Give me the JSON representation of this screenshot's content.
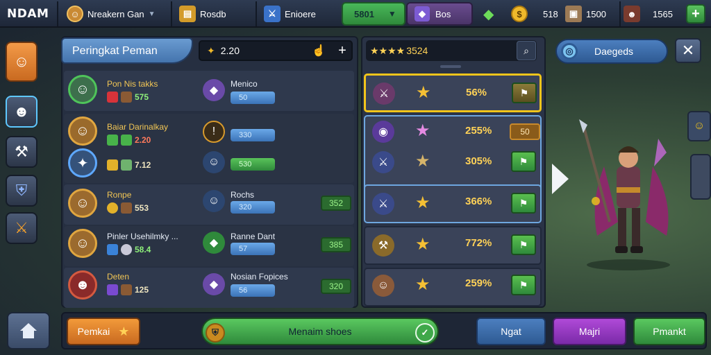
{
  "topbar": {
    "logo": "NDAM",
    "player_name": "Nreakern Gan",
    "res1_label": "Rosdb",
    "res2_label": "Enioere",
    "green_value": "5801",
    "purple_label": "Bos",
    "coins_value": "518",
    "chest_value": "1500",
    "energy_value": "1565"
  },
  "panel": {
    "title": "Peringkat Peman",
    "search_value": "2.20",
    "right_header_value": "3524",
    "details_label": "Daegeds"
  },
  "rows": [
    {
      "name": "Pon Nis takks",
      "stat": "575",
      "item": "Menico",
      "bar": "50",
      "badge": ""
    },
    {
      "name": "Baiar Darinalkay",
      "stat": "2.20",
      "item": "",
      "bar": "330",
      "badge": ""
    },
    {
      "name": "",
      "stat": "7.12",
      "item": "",
      "bar": "530",
      "badge": ""
    },
    {
      "name": "Ronpe",
      "stat": "553",
      "item": "Rochs",
      "bar": "320",
      "badge": "352"
    },
    {
      "name": "Pinler Usehilmky ...",
      "stat": "58.4",
      "item": "Ranne Dant",
      "bar": "57",
      "badge": "385"
    },
    {
      "name": "Deten",
      "stat": "125",
      "item": "Nosian Fopices",
      "bar": "56",
      "badge": "320"
    }
  ],
  "right_list": [
    {
      "pct": "56%"
    },
    {
      "pct": "255%",
      "badge": "50"
    },
    {
      "pct": "305%"
    },
    {
      "pct": "366%"
    },
    {
      "pct": "772%"
    },
    {
      "pct": "259%"
    }
  ],
  "bottom": {
    "left_label": "Pemkai",
    "center_label": "Menaim shoes",
    "btn1": "Ngat",
    "btn2": "Majri",
    "btn3": "Pmankt"
  },
  "colors": {
    "gold": "#f3c51b",
    "green": "#3fa84a",
    "purple": "#9b3fc9",
    "blue": "#3b73b7",
    "orange": "#e9831f"
  }
}
